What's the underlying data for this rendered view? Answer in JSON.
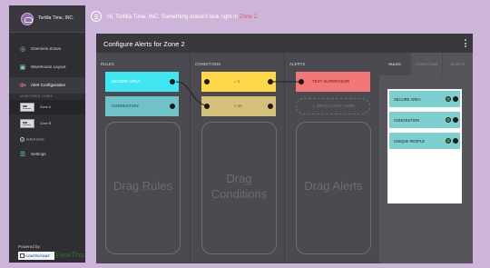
{
  "app": {
    "name": "Tortilla Time, INC.",
    "brand_color": "#8e6da6"
  },
  "sidebar": {
    "items": [
      {
        "label": "Overview Zones",
        "icon": "globe-icon"
      },
      {
        "label": "Warehouse Layout",
        "icon": "layout-icon"
      },
      {
        "label": "Alert Configuration",
        "icon": "alert-icon"
      }
    ],
    "section_header": "MONITORED ZONES",
    "zones": [
      {
        "label": "Zone A"
      },
      {
        "label": "Zone B"
      }
    ],
    "add_zone": "Add A Zone",
    "settings": "Settings",
    "powered_by": "Powered by:",
    "partner_name": "CONTEXTANT",
    "partner_brand": "ViewTrac"
  },
  "banner": {
    "text": "Hi, Tortilla Time, INC. Something doesn't look right in",
    "link": "Zone 2."
  },
  "panel": {
    "title": "Configure Alerts for Zone 2",
    "columns": {
      "rules": {
        "title": "RULES",
        "cards": [
          {
            "label": "SECURE AREA",
            "color": "#3fe6f2"
          },
          {
            "label": "CONGESTION",
            "color": "#6fc3c8"
          }
        ],
        "drop_text": "Drag Rules"
      },
      "conditions": {
        "title": "CONDITIONS",
        "cards": [
          {
            "label": "= 1",
            "color": "#ffd84a"
          },
          {
            "label": "> 10",
            "color": "#d4bf7b"
          }
        ],
        "drop_text": "Drag Conditions"
      },
      "alerts": {
        "title": "ALERTS",
        "cards": [
          {
            "label": "TEXT SUPERVISOR",
            "color": "#f37777"
          }
        ],
        "drag_alert_label": "DRAG ALERT HERE",
        "drop_text": "Drag Alerts"
      }
    },
    "right_panel": {
      "tabs": [
        "RULES",
        "CONDITIONS",
        "ALERTS"
      ],
      "active_tab": "RULES",
      "items": [
        {
          "label": "SECURE AREA"
        },
        {
          "label": "CONGESTION"
        },
        {
          "label": "UNIQUE PEOPLE"
        }
      ]
    }
  }
}
